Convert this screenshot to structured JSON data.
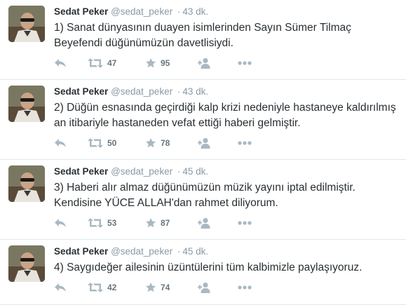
{
  "colors": {
    "icon": "#aab8c2",
    "count": "#66757f",
    "meta": "#8899a6",
    "text": "#292f33",
    "divider": "#e1e8ed"
  },
  "tweets": [
    {
      "name": "Sedat Peker",
      "handle": "@sedat_peker",
      "separator": "·",
      "time": "43 dk.",
      "lines": [
        "1) Sanat dünyasının duayen isimlerinden Sayın Sümer Tilmaç",
        "Beyefendi düğünümüzün davetlisiydi."
      ],
      "retweets": "47",
      "favorites": "95"
    },
    {
      "name": "Sedat Peker",
      "handle": "@sedat_peker",
      "separator": "·",
      "time": "43 dk.",
      "lines": [
        "2) Düğün esnasında geçirdiği kalp krizi nedeniyle hastaneye kaldırılmış",
        "an itibariyle hastaneden vefat ettiği haberi gelmiştir."
      ],
      "retweets": "50",
      "favorites": "78"
    },
    {
      "name": "Sedat Peker",
      "handle": "@sedat_peker",
      "separator": "·",
      "time": "45 dk.",
      "lines": [
        "3) Haberi alır almaz düğünümüzün müzik yayını iptal edilmiştir.",
        "Kendisine YÜCE ALLAH'dan rahmet diliyorum."
      ],
      "retweets": "53",
      "favorites": "87"
    },
    {
      "name": "Sedat Peker",
      "handle": "@sedat_peker",
      "separator": "·",
      "time": "45 dk.",
      "lines": [
        "4) Saygıdeğer ailesinin üzüntülerini tüm kalbimizle paylaşıyoruz."
      ],
      "retweets": "42",
      "favorites": "74"
    }
  ],
  "icons": {
    "reply": "reply-icon",
    "retweet": "retweet-icon",
    "favorite": "star-icon",
    "follow": "follow-user-icon",
    "more": "more-dots-icon"
  }
}
